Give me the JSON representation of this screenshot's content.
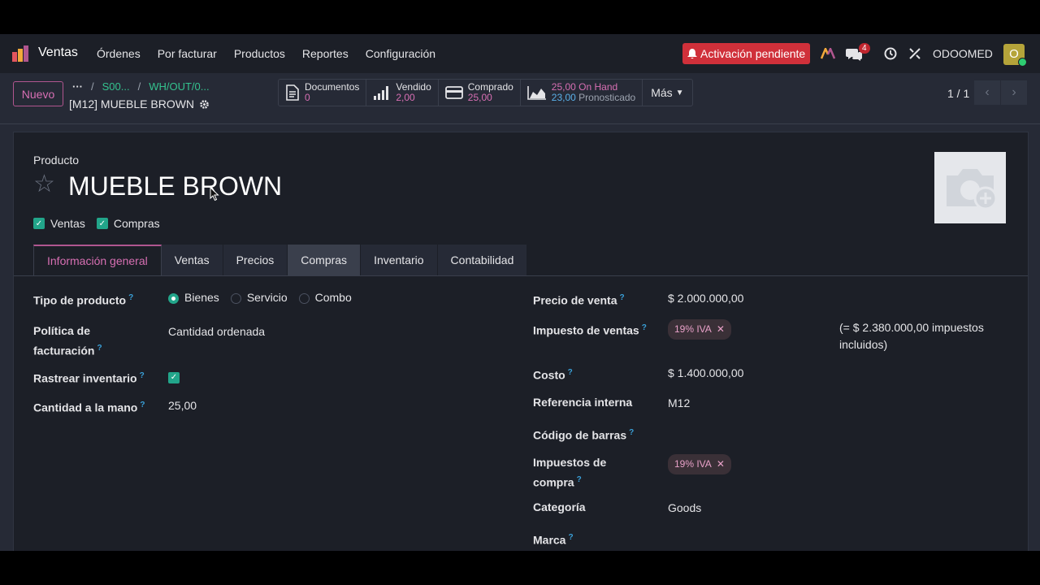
{
  "nav": {
    "brand": "Ventas",
    "menu": [
      "Órdenes",
      "Por facturar",
      "Productos",
      "Reportes",
      "Configuración"
    ],
    "pending_label": "Activación pendiente",
    "messages_count": "4",
    "company": "ODOOMED",
    "avatar_letter": "O"
  },
  "control": {
    "new_label": "Nuevo",
    "breadcrumb_more": "···",
    "breadcrumb": [
      "S00...",
      "WH/OUT/0..."
    ],
    "record_title": "[M12] MUEBLE BROWN",
    "stats": [
      {
        "label": "Documentos",
        "value": "0",
        "icon": "document-icon"
      },
      {
        "label": "Vendido",
        "value": "2,00",
        "icon": "signal-bars-icon"
      },
      {
        "label": "Comprado",
        "value": "25,00",
        "icon": "credit-card-icon"
      },
      {
        "label": "On Hand",
        "value": "25,00",
        "label2": "Pronosticado",
        "value2": "23,00",
        "icon": "area-chart-icon"
      }
    ],
    "more_label": "Más",
    "pager": "1 / 1"
  },
  "form": {
    "product_label": "Producto",
    "name": "MUEBLE BROWN",
    "can_sell_label": "Ventas",
    "can_purchase_label": "Compras",
    "tabs": [
      "Información general",
      "Ventas",
      "Precios",
      "Compras",
      "Inventario",
      "Contabilidad"
    ],
    "left": {
      "product_type_label": "Tipo de producto",
      "type_options": [
        "Bienes",
        "Servicio",
        "Combo"
      ],
      "invoice_policy_label_1": "Política de",
      "invoice_policy_label_2": "facturación",
      "invoice_policy_value": "Cantidad ordenada",
      "track_inventory_label": "Rastrear inventario",
      "qty_on_hand_label": "Cantidad a la mano",
      "qty_on_hand_value": "25,00"
    },
    "right": {
      "sale_price_label": "Precio de venta",
      "sale_price_value": "$ 2.000.000,00",
      "sales_tax_label": "Impuesto de ventas",
      "sales_tax_tag": "19% IVA",
      "tax_included_1": "(= $ 2.380.000,00 impuestos",
      "tax_included_2": "incluidos)",
      "cost_label": "Costo",
      "cost_value": "$ 1.400.000,00",
      "internal_ref_label": "Referencia interna",
      "internal_ref_value": "M12",
      "barcode_label": "Código de barras",
      "purchase_tax_label_1": "Impuestos de",
      "purchase_tax_label_2": "compra",
      "purchase_tax_tag": "19% IVA",
      "category_label": "Categoría",
      "category_value": "Goods",
      "brand_label": "Marca"
    }
  },
  "colors": {
    "accent": "#d76fb3",
    "success": "#22a58a",
    "danger": "#d0303a",
    "link": "#34c38f"
  }
}
